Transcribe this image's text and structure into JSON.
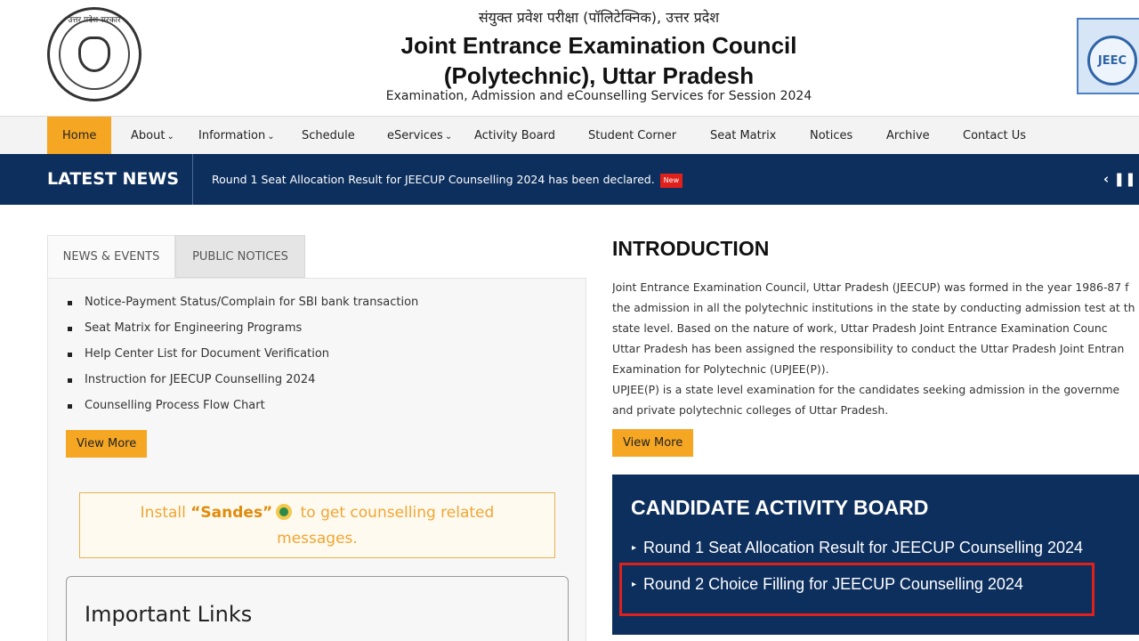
{
  "header": {
    "hindi_title": "संयुक्त प्रवेश परीक्षा (पॉलिटेक्निक), उत्तर प्रदेश",
    "title_line1": "Joint Entrance Examination Council",
    "title_line2": "(Polytechnic), Uttar Pradesh",
    "subtitle": "Examination, Admission and eCounselling Services for Session 2024",
    "emblem_text": "उत्तर प्रदेश सरकार",
    "logo_text": "JEEC"
  },
  "nav": {
    "items": [
      "Home",
      "About",
      "Information",
      "Schedule",
      "eServices",
      "Activity Board",
      "Student Corner",
      "Seat Matrix",
      "Notices",
      "Archive",
      "Contact Us"
    ],
    "active": "Home"
  },
  "news": {
    "label": "LATEST NEWS",
    "text": "Round 1 Seat Allocation Result for JEECUP Counselling 2024 has been declared.",
    "badge": "New",
    "controls": "‹ ❚❚ ›"
  },
  "left": {
    "tabs": [
      "NEWS & EVENTS",
      "PUBLIC NOTICES"
    ],
    "notices": [
      "Notice-Payment Status/Complain for SBI bank transaction",
      "Seat Matrix for Engineering Programs",
      "Help Center List for Document Verification",
      "Instruction for JEECUP Counselling 2024",
      "Counselling Process Flow Chart"
    ],
    "view_more": "View More",
    "sandes": {
      "prefix": "Install ",
      "name": "“Sandes”",
      "suffix": " to get counselling related",
      "line2": "messages."
    },
    "important_links": "Important Links"
  },
  "right": {
    "intro_title": "INTRODUCTION",
    "intro_lines": [
      "Joint Entrance Examination Council, Uttar Pradesh (JEECUP) was formed in the year 1986-87 f",
      "the admission in all the polytechnic institutions in the state by conducting admission test at th",
      "state level. Based on the nature of work, Uttar Pradesh Joint Entrance Examination Counc",
      "Uttar Pradesh has been assigned the responsibility to conduct the Uttar Pradesh Joint Entran",
      "Examination for Polytechnic (UPJEE(P)).",
      "UPJEE(P) is a state level examination for the candidates seeking admission in the governme",
      "and private polytechnic colleges of Uttar Pradesh."
    ],
    "view_more": "View More",
    "activity_title": "CANDIDATE ACTIVITY BOARD",
    "activity_items": [
      "Round 1 Seat Allocation Result for JEECUP Counselling 2024",
      "Round 2 Choice Filling for JEECUP Counselling 2024"
    ]
  }
}
